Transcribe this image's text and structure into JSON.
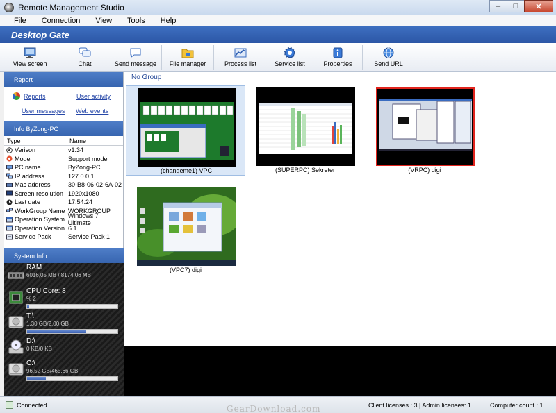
{
  "window": {
    "title": "Remote Management Studio"
  },
  "menu": [
    "File",
    "Connection",
    "View",
    "Tools",
    "Help"
  ],
  "header": {
    "title": "Desktop Gate"
  },
  "toolbar": [
    {
      "label": "View screen",
      "icon": "monitor-icon"
    },
    {
      "label": "Chat",
      "icon": "chat-bubbles-icon"
    },
    {
      "label": "Send message",
      "icon": "message-bubble-icon"
    },
    {
      "label": "File manager",
      "icon": "folder-icon"
    },
    {
      "label": "Process list",
      "icon": "process-chart-icon"
    },
    {
      "label": "Service list",
      "icon": "gear-icon"
    },
    {
      "label": "Properties",
      "icon": "info-icon"
    },
    {
      "label": "Send URL",
      "icon": "globe-icon"
    }
  ],
  "report": {
    "title": "Report",
    "links": [
      "Reports",
      "User activity",
      "User messages",
      "Web events"
    ]
  },
  "info": {
    "title": "Info ByZong-PC",
    "col_type": "Type",
    "col_name": "Name",
    "rows": [
      {
        "k": "Verison",
        "v": "v1.34",
        "icon": "q-icon"
      },
      {
        "k": "Mode",
        "v": "Support mode",
        "icon": "lifebuoy-icon"
      },
      {
        "k": "PC name",
        "v": "ByZong-PC",
        "icon": "pc-icon"
      },
      {
        "k": "IP address",
        "v": "127.0.0.1",
        "icon": "network-icon"
      },
      {
        "k": "Mac address",
        "v": "30-B8-06-02-6A-02",
        "icon": "network-card-icon"
      },
      {
        "k": "Screen resolution",
        "v": "1920x1080",
        "icon": "monitor-icon"
      },
      {
        "k": "Last date",
        "v": "17:54:24",
        "icon": "clock-icon"
      },
      {
        "k": "WorkGroup Name",
        "v": "WORKGROUP",
        "icon": "workgroup-icon"
      },
      {
        "k": "Operation System",
        "v": "Windows 7 Ultimate",
        "icon": "window-icon"
      },
      {
        "k": "Operation Version",
        "v": "6.1",
        "icon": "window-icon"
      },
      {
        "k": "Service Pack",
        "v": "Service Pack 1",
        "icon": "package-icon"
      }
    ]
  },
  "system": {
    "title": "System Info",
    "items": [
      {
        "name": "RAM",
        "value": "6016,05 MB / 8174,06 MB",
        "fill": null,
        "icon": "ram-icon"
      },
      {
        "name": "CPU Core: 8",
        "value": "% 2",
        "fill": 0.02,
        "icon": "cpu-icon"
      },
      {
        "name": "T:\\",
        "value": "1,30 GB/2,00 GB",
        "fill": 0.65,
        "icon": "hard-drive-icon"
      },
      {
        "name": "D:\\",
        "value": "0 KB/0 KB",
        "fill": null,
        "icon": "cd-drive-icon"
      },
      {
        "name": "C:\\",
        "value": "96,52 GB/465,66 GB",
        "fill": 0.21,
        "icon": "hard-drive-icon"
      }
    ]
  },
  "group": {
    "title": "No Group"
  },
  "computers": [
    {
      "label": "(changeme1) VPC",
      "selected": true,
      "highlight": false,
      "screen": "solitaire"
    },
    {
      "label": "(SUPERPC) Sekreter",
      "selected": false,
      "highlight": false,
      "screen": "spreadsheet"
    },
    {
      "label": "(VRPC) digi",
      "selected": false,
      "highlight": true,
      "screen": "desktop-windows"
    },
    {
      "label": "(VPC7) digi",
      "selected": false,
      "highlight": false,
      "screen": "windows7"
    }
  ],
  "status": {
    "connected": "Connected",
    "licenses": "Client licenses : 3 | Admin licenses: 1",
    "computer_count": "Computer count : 1"
  },
  "watermark": "GearDownload.com",
  "colors": {
    "header_blue": "#2c57a6",
    "selected_border": "#e1241d",
    "link": "#2748a8"
  }
}
